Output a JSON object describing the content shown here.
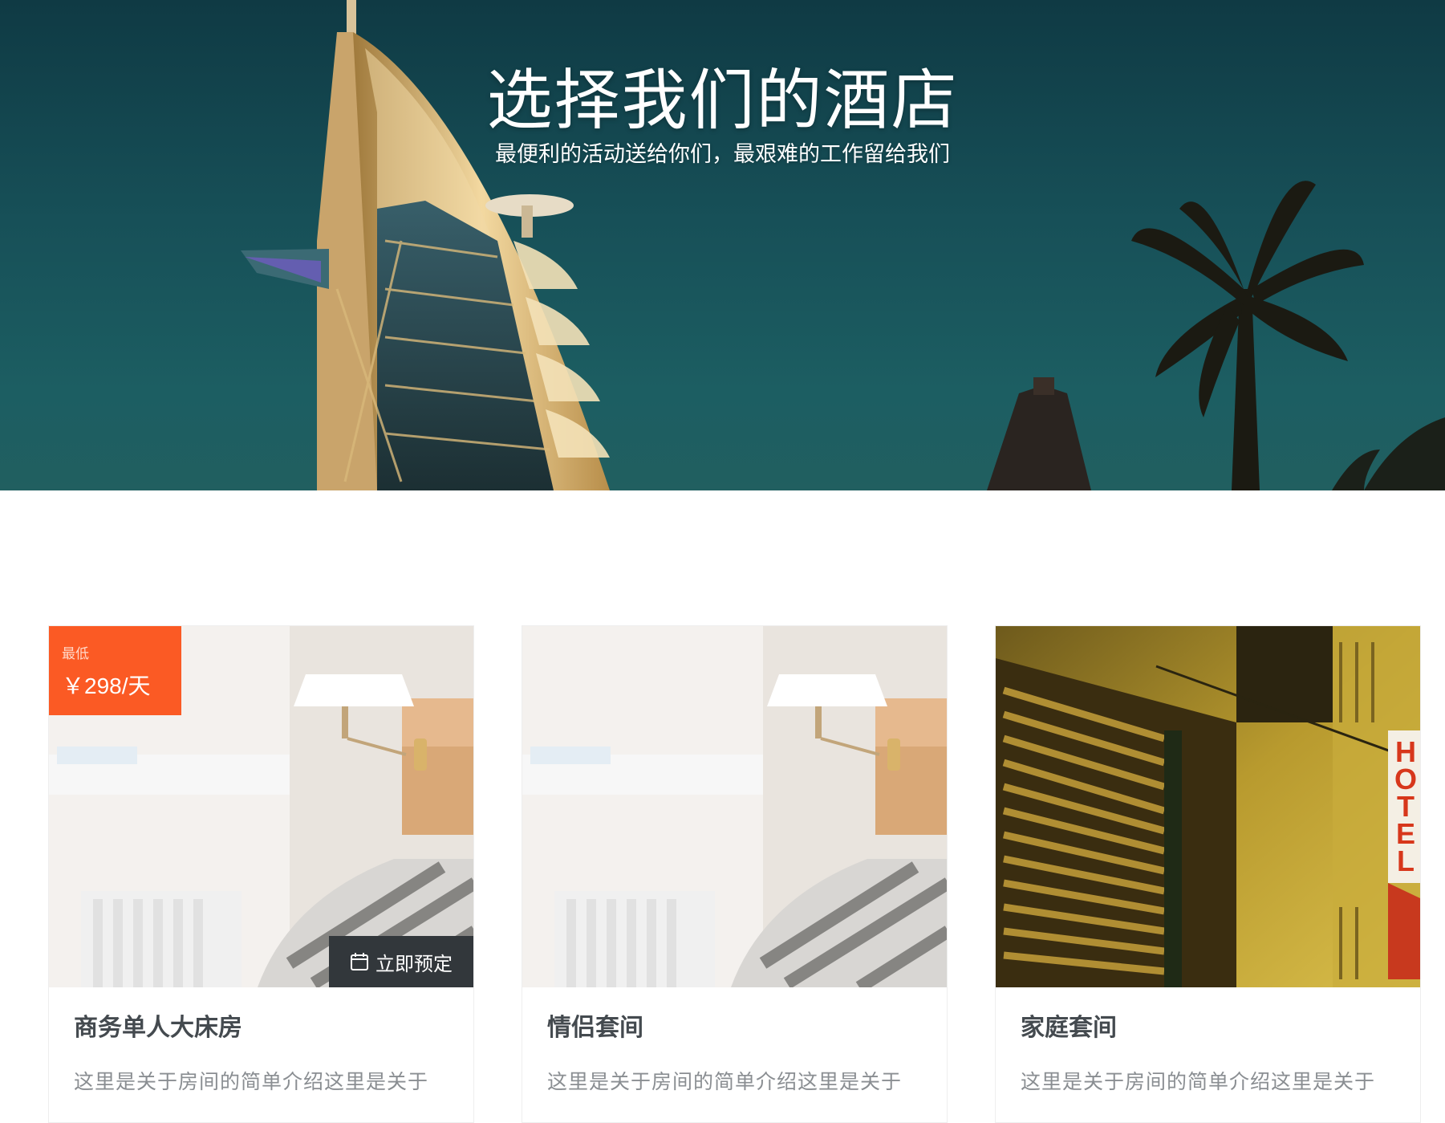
{
  "hero": {
    "title": "选择我们的酒店",
    "subtitle": "最便利的活动送给你们，最艰难的工作留给我们"
  },
  "rooms": [
    {
      "name": "商务单人大床房",
      "description": "这里是关于房间的简单介绍这里是关于",
      "price_label": "最低",
      "price": "￥298/天",
      "book_label": "立即预定",
      "image": "bedroom-photo"
    },
    {
      "name": "情侣套间",
      "description": "这里是关于房间的简单介绍这里是关于",
      "image": "bedroom-photo"
    },
    {
      "name": "家庭套间",
      "description": "这里是关于房间的简单介绍这里是关于",
      "image": "hotel-street-photo",
      "sign_text": "HOTEL"
    }
  ],
  "colors": {
    "accent": "#fb5a24",
    "book_button": "#32373b",
    "hero_sky": "#175058",
    "title_text": "#444a4f",
    "desc_text": "#8a8e92"
  },
  "icons": {
    "book": "calendar-icon"
  }
}
